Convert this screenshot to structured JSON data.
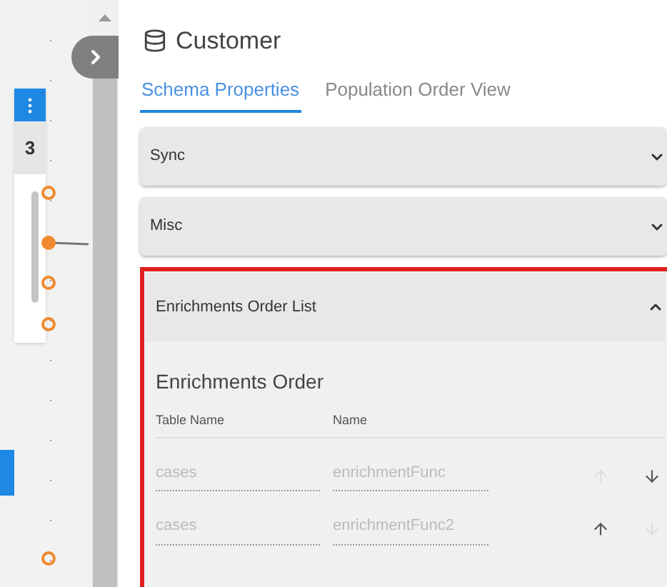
{
  "node": {
    "count": "3"
  },
  "panel": {
    "title": "Customer"
  },
  "tabs": [
    {
      "label": "Schema Properties",
      "selected": true
    },
    {
      "label": "Population Order View",
      "selected": false
    }
  ],
  "sections": [
    {
      "title": "Sync",
      "expanded": false
    },
    {
      "title": "Misc",
      "expanded": false
    },
    {
      "title": "Enrichments Order List",
      "expanded": true,
      "highlighted": true
    }
  ],
  "enrichments": {
    "heading": "Enrichments Order",
    "columns": [
      "Table Name",
      "Name"
    ],
    "rows": [
      {
        "table_name": "cases",
        "name": "enrichmentFunc",
        "up_disabled": true,
        "down_disabled": false
      },
      {
        "table_name": "cases",
        "name": "enrichmentFunc2",
        "up_disabled": false,
        "down_disabled": true
      }
    ]
  }
}
